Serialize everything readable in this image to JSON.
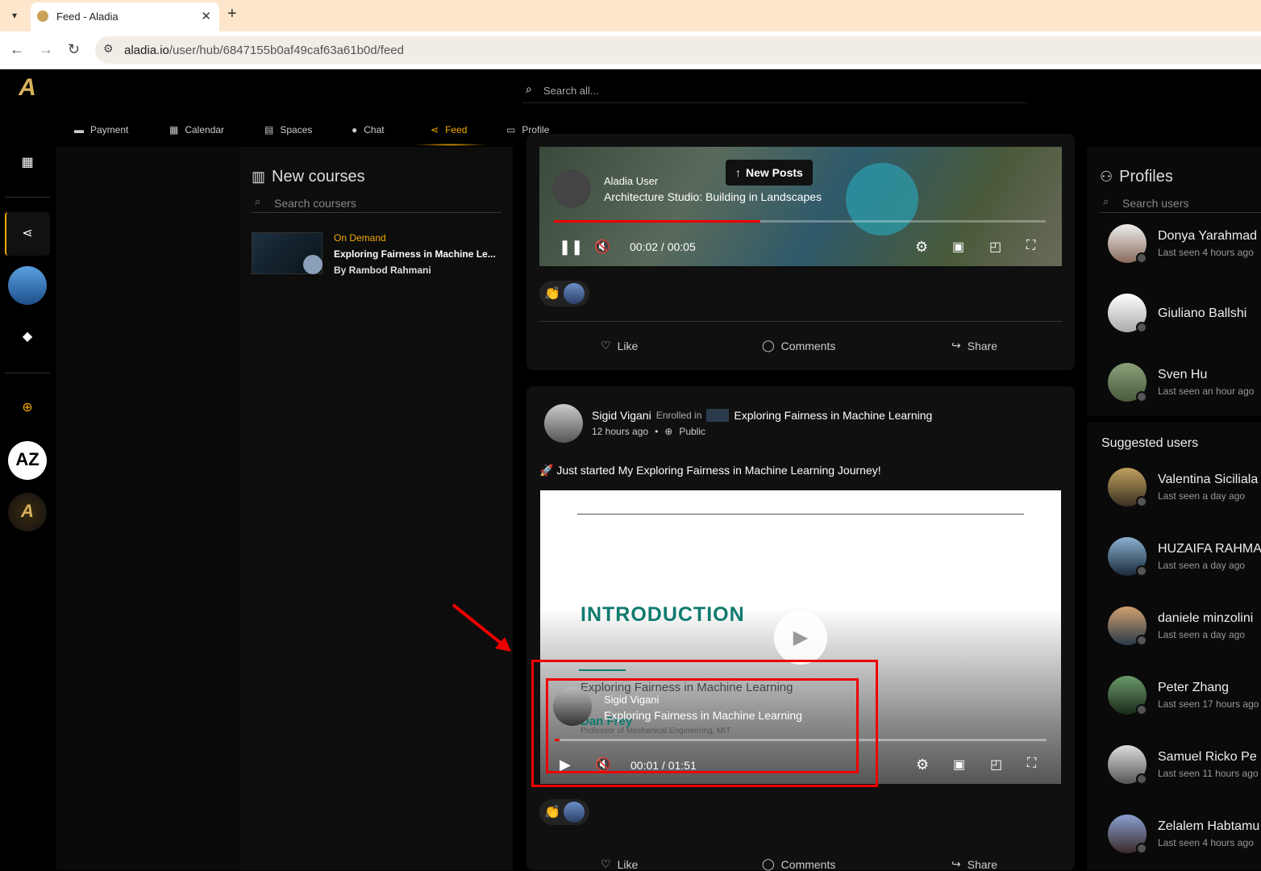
{
  "browser": {
    "tab_title": "Feed - Aladia",
    "url_host": "aladia.io",
    "url_path": "/user/hub/6847155b0af49caf63a61b0d/feed"
  },
  "topbar": {
    "search_placeholder": "Search all...",
    "nav": [
      {
        "label": "Payment"
      },
      {
        "label": "Calendar"
      },
      {
        "label": "Spaces"
      },
      {
        "label": "Chat"
      },
      {
        "label": "Feed"
      },
      {
        "label": "Profile"
      }
    ],
    "active_nav": "Feed"
  },
  "courses": {
    "title": "New courses",
    "search_placeholder": "Search coursers",
    "items": [
      {
        "badge": "On Demand",
        "title": "Exploring Fairness in Machine Le...",
        "author": "By Rambod Rahmani"
      }
    ]
  },
  "feed": {
    "new_posts_label": "New Posts",
    "post1": {
      "overlay_user": "Aladia User",
      "overlay_title": "Architecture Studio: Building in Landscapes",
      "time": "00:02 / 00:05",
      "progress": 0.42
    },
    "post2": {
      "user": "Sigid Vigani",
      "enrolled_label": "Enrolled in",
      "course": "Exploring Fairness in Machine Learning",
      "time_ago": "12 hours ago",
      "visibility": "Public",
      "text": "🚀 Just started My Exploring Fairness in Machine Learning Journey!",
      "slide_heading": "INTRODUCTION",
      "slide_subtitle": "Exploring Fairness in Machine Learning",
      "slide_presenter": "Dan Frey",
      "slide_role": "Professor of Mechanical Engineering, MIT",
      "overlay_user": "Sigid Vigani",
      "overlay_title": "Exploring Fairness in Machine Learning",
      "time": "00:01 / 01:51",
      "progress": 0.01
    },
    "actions": {
      "like": "Like",
      "comments": "Comments",
      "share": "Share"
    }
  },
  "profiles": {
    "title": "Profiles",
    "search_placeholder": "Search users",
    "items": [
      {
        "name": "Donya Yarahmad",
        "seen": "Last seen 4 hours ago"
      },
      {
        "name": "Giuliano Ballshi",
        "seen": ""
      },
      {
        "name": "Sven Hu",
        "seen": "Last seen an hour ago"
      }
    ],
    "suggested_title": "Suggested users",
    "suggested": [
      {
        "name": "Valentina Siciliala",
        "seen": "Last seen a day ago"
      },
      {
        "name": "HUZAIFA RAHMA",
        "seen": "Last seen a day ago"
      },
      {
        "name": "daniele minzolini",
        "seen": "Last seen a day ago"
      },
      {
        "name": "Peter Zhang",
        "seen": "Last seen 17 hours ago"
      },
      {
        "name": "Samuel Ricko Pe",
        "seen": "Last seen 11 hours ago"
      },
      {
        "name": "Zelalem Habtamu",
        "seen": "Last seen 4 hours ago"
      }
    ]
  },
  "colors": {
    "accent": "#f2a900",
    "annotation": "#e00000"
  }
}
